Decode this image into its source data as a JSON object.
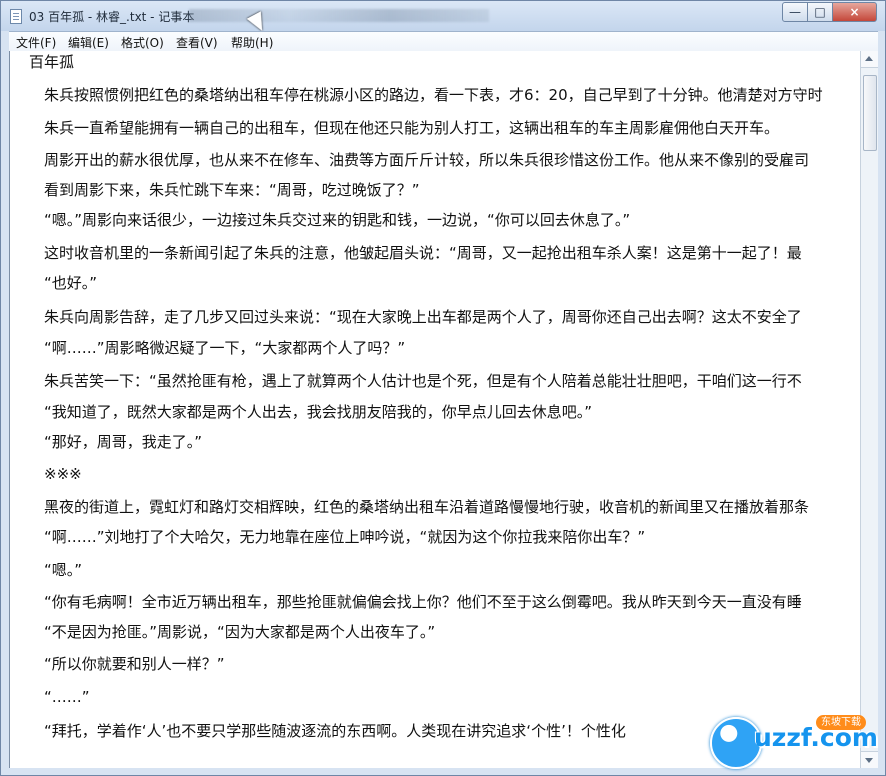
{
  "window": {
    "title": "03 百年孤 - 林睿_.txt - 记事本"
  },
  "menu": [
    {
      "label": "文件(F)"
    },
    {
      "label": "编辑(E)"
    },
    {
      "label": "格式(O)"
    },
    {
      "label": "查看(V)"
    },
    {
      "label": "帮助(H)"
    }
  ],
  "lines": [
    "百年孤",
    "朱兵按照惯例把红色的桑塔纳出租车停在桃源小区的路边，看一下表，才6：20，自己早到了十分钟。他清楚对方守时",
    "朱兵一直希望能拥有一辆自己的出租车，但现在他还只能为别人打工，这辆出租车的车主周影雇佣他白天开车。",
    "周影开出的薪水很优厚，也从来不在修车、油费等方面斤斤计较，所以朱兵很珍惜这份工作。他从来不像别的受雇司",
    "看到周影下来，朱兵忙跳下车来：“周哥，吃过晚饭了？”",
    "“嗯。”周影向来话很少，一边接过朱兵交过来的钥匙和钱，一边说，“你可以回去休息了。”",
    "这时收音机里的一条新闻引起了朱兵的注意，他皱起眉头说：“周哥，又一起抢出租车杀人案！这是第十一起了！最",
    "“也好。”",
    "朱兵向周影告辞，走了几步又回过头来说：“现在大家晚上出车都是两个人了，周哥你还自己出去啊？这太不安全了",
    "“啊……”周影略微迟疑了一下，“大家都两个人了吗？”",
    "朱兵苦笑一下：“虽然抢匪有枪，遇上了就算两个人估计也是个死，但是有个人陪着总能壮壮胆吧，干咱们这一行不",
    "“我知道了，既然大家都是两个人出去，我会找朋友陪我的，你早点儿回去休息吧。”",
    "“那好，周哥，我走了。”",
    "※※※",
    "黑夜的街道上，霓虹灯和路灯交相辉映，红色的桑塔纳出租车沿着道路慢慢地行驶，收音机的新闻里又在播放着那条",
    "“啊……”刘地打了个大哈欠，无力地靠在座位上呻吟说，“就因为这个你拉我来陪你出车？”",
    "“嗯。”",
    "“你有毛病啊！全市近万辆出租车，那些抢匪就偏偏会找上你？他们不至于这么倒霉吧。我从昨天到今天一直没有睡",
    "“不是因为抢匪。”周影说，“因为大家都是两个人出夜车了。”",
    "“所以你就要和别人一样？”",
    "“……”",
    "“拜托，学着作‘人’也不要只学那些随波逐流的东西啊。人类现在讲究追求‘个性’！个性化"
  ],
  "watermark": {
    "text": "uzzf.com",
    "label": "东坡下载"
  },
  "colors": {
    "titlebar": "#c3d5ec",
    "close": "#c4473a",
    "text": "#111111",
    "logo": "#1594ee"
  }
}
